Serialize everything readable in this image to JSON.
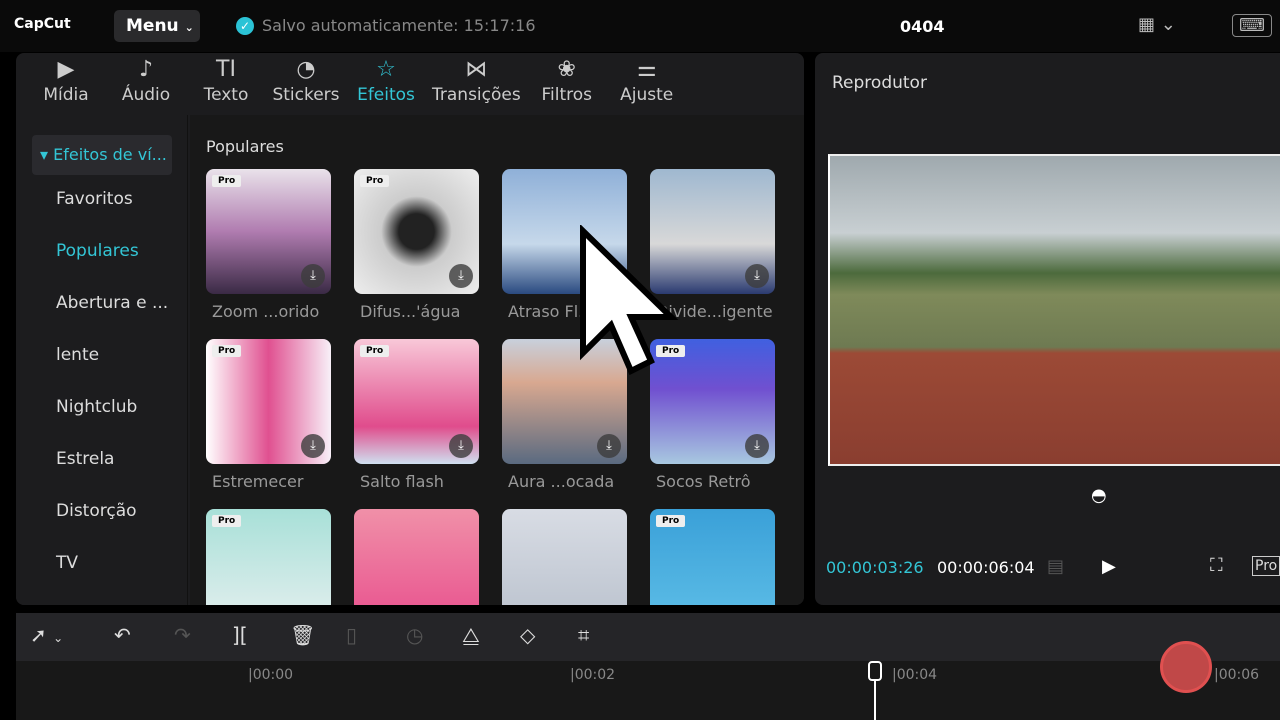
{
  "app": {
    "logo": "CapCut",
    "menu": "Menu",
    "saved": "Salvo automaticamente: 15:17:16",
    "project": "0404"
  },
  "tabs": [
    {
      "label": "Mídia",
      "icon": "▶"
    },
    {
      "label": "Áudio",
      "icon": "♪"
    },
    {
      "label": "Texto",
      "icon": "TI"
    },
    {
      "label": "Stickers",
      "icon": "◔"
    },
    {
      "label": "Efeitos",
      "icon": "☆",
      "active": true
    },
    {
      "label": "Transições",
      "icon": "⋈"
    },
    {
      "label": "Filtros",
      "icon": "❀"
    },
    {
      "label": "Ajuste",
      "icon": "⚌"
    }
  ],
  "sidebar": {
    "category": "▾ Efeitos de ví...",
    "items": [
      "Favoritos",
      "Populares",
      "Abertura e ...",
      "lente",
      "Nightclub",
      "Estrela",
      "Distorção",
      "TV"
    ],
    "active": "Populares"
  },
  "section": "Populares",
  "effects": [
    {
      "name": "Zoom ...orido",
      "pro": "Pro",
      "bg": "linear-gradient(#e9e2ea,#b07cb0 50%,#3a2a45)"
    },
    {
      "name": "Difus...'água",
      "pro": "Pro",
      "bg": "radial-gradient(circle,#222 20%,#ccc 40%,#eee)"
    },
    {
      "name": "Atraso Fl...",
      "pro": "",
      "bg": "linear-gradient(#8fb0d8,#c6d8ea 60%,#2a4a80)"
    },
    {
      "name": "Divide...igente",
      "pro": "",
      "bg": "linear-gradient(#9fb8d0,#d8d8d8 60%,#2a3a70)"
    },
    {
      "name": "Estremecer",
      "pro": "Pro",
      "bg": "linear-gradient(90deg,#fff,#e05090 50%,#f8f0f8)"
    },
    {
      "name": "Salto flash",
      "pro": "Pro",
      "bg": "linear-gradient(#f8c8d8,#e04c8c 70%,#cfe0f0)"
    },
    {
      "name": "Aura ...ocada",
      "pro": "",
      "bg": "linear-gradient(#c8d0dc,#d8a890 35%,#5a6a80)"
    },
    {
      "name": "Socos Retrô",
      "pro": "Pro",
      "bg": "linear-gradient(#4060e0,#7050d0 40%,#a8c8e0)"
    },
    {
      "name": "",
      "pro": "Pro",
      "bg": "linear-gradient(#a8e0d8,#e8f0f0)"
    },
    {
      "name": "",
      "pro": "",
      "bg": "linear-gradient(#f090a8,#e84c8c)"
    },
    {
      "name": "",
      "pro": "",
      "bg": "linear-gradient(#d8dce4,#b8c0cc)"
    },
    {
      "name": "",
      "pro": "Pro",
      "bg": "linear-gradient(#3aa0d8,#60c0e8)"
    }
  ],
  "player": {
    "title": "Reprodutor",
    "current": "00:00:03:26",
    "total": "00:00:06:04",
    "ratio": "Pro"
  },
  "timeline": {
    "ticks": [
      "|00:00",
      "|00:02",
      "|00:04",
      "|00:06"
    ]
  }
}
